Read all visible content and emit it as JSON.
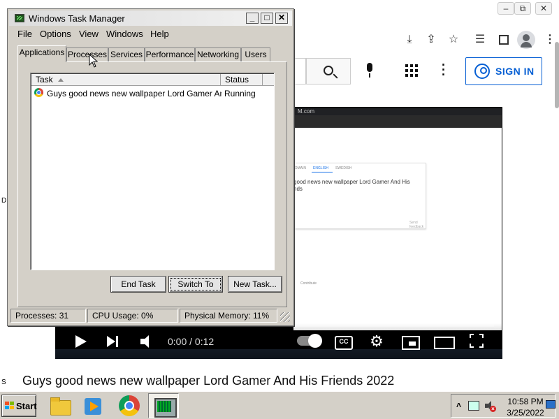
{
  "browser": {
    "window_controls": [
      "–",
      "⧉",
      "✕"
    ],
    "signin_label": "SIGN IN"
  },
  "video": {
    "time": "0:00 / 0:12",
    "title": "Guys good news new wallpaper Lord Gamer And His Friends 2022",
    "frame_brand": "M.com",
    "frame_tabs": [
      "DOMAIN",
      "ENGLISH",
      "SWEDISH"
    ],
    "frame_text": "good news new wallpaper Lord Gamer And His nds",
    "frame_send": "Send feedback",
    "frame_contrib": "Contribute"
  },
  "edge_marks": [
    "D",
    "S"
  ],
  "task_manager": {
    "title": "Windows Task Manager",
    "caption_buttons": [
      "_",
      "□",
      "✕"
    ],
    "menu": [
      "File",
      "Options",
      "View",
      "Windows",
      "Help"
    ],
    "tabs": [
      "Applications",
      "Processes",
      "Services",
      "Performance",
      "Networking",
      "Users"
    ],
    "active_tab": "Applications",
    "columns": {
      "task": "Task",
      "status": "Status"
    },
    "tasks": [
      {
        "name": "Guys good news new wallpaper Lord Gamer And ...",
        "status": "Running"
      }
    ],
    "buttons": {
      "end_task": "End Task",
      "switch_to": "Switch To",
      "new_task": "New Task..."
    },
    "status_bar": {
      "processes": "Processes: 31",
      "cpu": "CPU Usage: 0%",
      "memory": "Physical Memory: 11%"
    }
  },
  "taskbar": {
    "start_label": "Start",
    "apps": [
      "folder-icon",
      "media-player-icon",
      "chrome-icon",
      "task-manager-icon"
    ],
    "tray_expand": "˄",
    "clock_time": "10:58 PM",
    "clock_date": "3/25/2022"
  }
}
